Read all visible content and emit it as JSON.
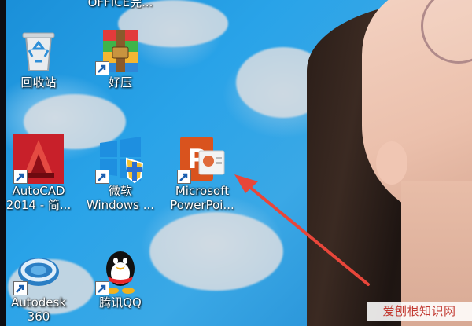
{
  "desktop": {
    "icons": [
      {
        "id": "top",
        "label": "OFFICE完..."
      },
      {
        "id": "recycle",
        "label": "回收站"
      },
      {
        "id": "haozip",
        "label": "好压"
      },
      {
        "id": "autocad",
        "label": [
          "AutoCAD",
          "2014 - 简..."
        ]
      },
      {
        "id": "windows",
        "label": [
          "微软",
          "Windows ..."
        ]
      },
      {
        "id": "powerpoint",
        "label": [
          "Microsoft",
          "PowerPoi..."
        ]
      },
      {
        "id": "autodesk",
        "label": [
          "Autodesk",
          "360"
        ]
      },
      {
        "id": "qq",
        "label": "腾讯QQ"
      }
    ]
  },
  "watermark": "爱刨根知识网",
  "colors": {
    "arrow": "#e8463a",
    "ppt": "#d9531e",
    "autocad": "#d82a2a"
  }
}
